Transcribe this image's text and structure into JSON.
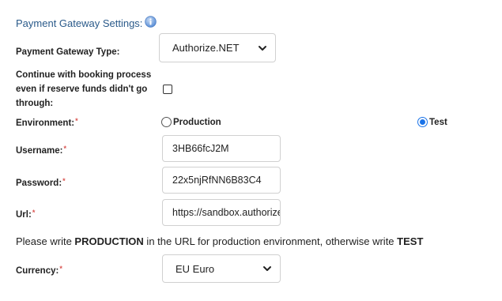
{
  "section": {
    "title": "Payment Gateway Settings:"
  },
  "gateway_type": {
    "label": "Payment Gateway Type:",
    "value": "Authorize.NET"
  },
  "continue_booking": {
    "label_line1": "Continue with booking process",
    "label_line2": "even if reserve funds didn't go",
    "label_line3": "through:",
    "checked": false
  },
  "environment": {
    "label": "Environment:",
    "options": [
      {
        "label": "Production",
        "checked": false
      },
      {
        "label": "Test",
        "checked": true
      }
    ]
  },
  "username": {
    "label": "Username:",
    "value": "3HB66fcJ2M"
  },
  "password": {
    "label": "Password:",
    "value": "22x5njRfNN6B83C4"
  },
  "url": {
    "label": "Url:",
    "value": "https://sandbox.authorize"
  },
  "note": {
    "part1": "Please write ",
    "keyword1": "PRODUCTION",
    "part2": " in the URL for production environment, otherwise write ",
    "keyword2": "TEST"
  },
  "currency": {
    "label": "Currency:",
    "value": "EU Euro"
  },
  "required_marker": "*",
  "colors": {
    "title": "#2a5a8a",
    "required": "#d9534f",
    "radio_accent": "#1a73e8"
  }
}
